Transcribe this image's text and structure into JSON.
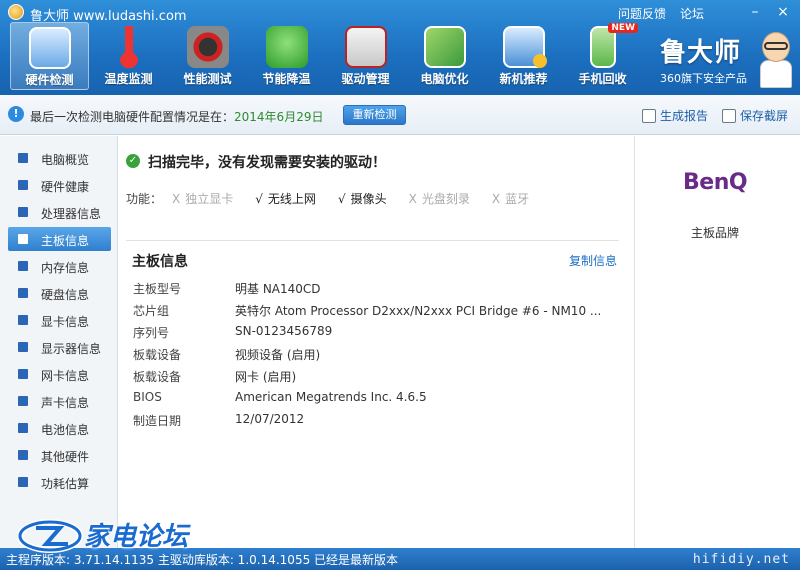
{
  "titlebar": {
    "app_title": "鲁大师 www.ludashi.com",
    "links": [
      "问题反馈",
      "论坛"
    ],
    "minimize": "–",
    "close": "×"
  },
  "tabs": [
    {
      "label": "硬件检测",
      "icon": "hardware-check-icon",
      "active": true
    },
    {
      "label": "温度监测",
      "icon": "thermometer-icon"
    },
    {
      "label": "性能测试",
      "icon": "speedometer-icon"
    },
    {
      "label": "节能降温",
      "icon": "clover-icon"
    },
    {
      "label": "驱动管理",
      "icon": "driver-toolbox-icon"
    },
    {
      "label": "电脑优化",
      "icon": "optimize-icon"
    },
    {
      "label": "新机推荐",
      "icon": "monitor-award-icon"
    },
    {
      "label": "手机回收",
      "icon": "phone-recycle-icon",
      "badge": "NEW"
    }
  ],
  "brand": {
    "name": "鲁大师",
    "subtitle": "360旗下安全产品"
  },
  "infobar": {
    "text": "最后一次检测电脑硬件配置情况是在：",
    "date": "2014年6月29日",
    "recheck": "重新检测",
    "report": "生成报告",
    "screenshot": "保存截屏"
  },
  "sidebar": [
    "电脑概览",
    "硬件健康",
    "处理器信息",
    "主板信息",
    "内存信息",
    "硬盘信息",
    "显卡信息",
    "显示器信息",
    "网卡信息",
    "声卡信息",
    "电池信息",
    "其他硬件",
    "功耗估算"
  ],
  "sidebar_active": 3,
  "main": {
    "scan_title": "扫描完毕，没有发现需要安装的驱动！",
    "features_label": "功能：",
    "features": [
      {
        "mark": "X",
        "label": "独立显卡",
        "on": false
      },
      {
        "mark": "√",
        "label": "无线上网",
        "on": true
      },
      {
        "mark": "√",
        "label": "摄像头",
        "on": true
      },
      {
        "mark": "X",
        "label": "光盘刻录",
        "on": false
      },
      {
        "mark": "X",
        "label": "蓝牙",
        "on": false
      }
    ],
    "section_title": "主板信息",
    "copy_link": "复制信息",
    "rows": [
      {
        "k": "主板型号",
        "v": "明基 NA140CD"
      },
      {
        "k": "芯片组",
        "v": "英特尔 Atom Processor D2xxx/N2xxx PCI Bridge #6 - NM10 ..."
      },
      {
        "k": "序列号",
        "v": "SN-0123456789"
      },
      {
        "k": "板载设备",
        "v": "视频设备 (启用)"
      },
      {
        "k": "板载设备",
        "v": "网卡 (启用)"
      },
      {
        "k": "BIOS",
        "v": "American Megatrends Inc. 4.6.5"
      },
      {
        "k": "制造日期",
        "v": "12/07/2012"
      }
    ]
  },
  "right": {
    "logo": "BenQ",
    "caption": "主板品牌"
  },
  "status": {
    "text": "主程序版本: 3.71.14.1135  主驱动库版本: 1.0.14.1055   已经是最新版本",
    "watermark": "hifidiy.net"
  },
  "forum": {
    "text": "家电论坛"
  },
  "colors": {
    "accent": "#1c6fbf",
    "active_side": "#2f7fcf",
    "date_green": "#2e8b2e",
    "benq_purple": "#6a2a87"
  }
}
